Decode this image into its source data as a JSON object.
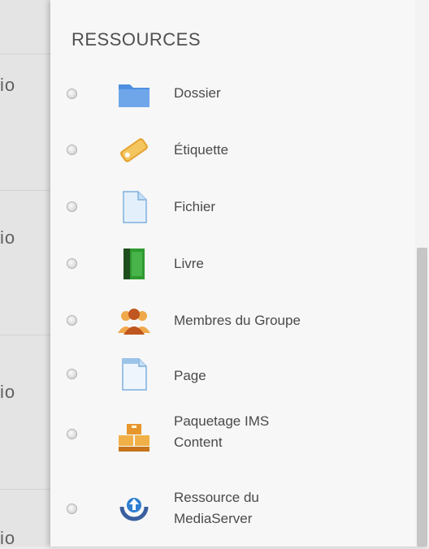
{
  "background": {
    "fragments": [
      "io",
      "io",
      "io",
      "io"
    ]
  },
  "panel": {
    "title": "RESSOURCES",
    "items": [
      {
        "label": "Dossier",
        "icon": "folder-icon"
      },
      {
        "label": "Étiquette",
        "icon": "label-tag-icon"
      },
      {
        "label": "Fichier",
        "icon": "file-icon"
      },
      {
        "label": "Livre",
        "icon": "book-icon"
      },
      {
        "label": "Membres du Groupe",
        "icon": "group-members-icon"
      },
      {
        "label": "Page",
        "icon": "page-icon"
      },
      {
        "label_lines": [
          "Paquetage IMS",
          "Content"
        ],
        "icon": "ims-package-icon"
      },
      {
        "label_lines": [
          "Ressource du",
          "MediaServer"
        ],
        "icon": "upload-icon"
      }
    ]
  },
  "colors": {
    "folder": "#4f8fe0",
    "tag": "#e6a532",
    "book": "#2f9a2f",
    "group": "#e08a2a",
    "package": "#e7962c",
    "upload": "#2f7ed1"
  }
}
